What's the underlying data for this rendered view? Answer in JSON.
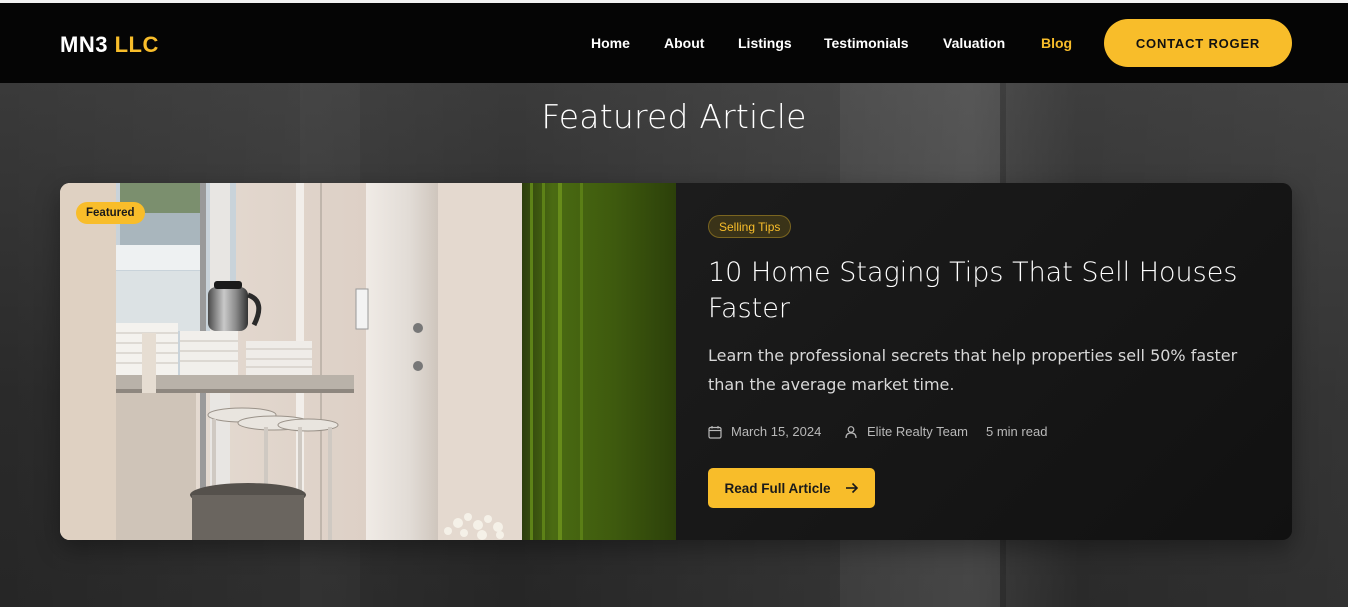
{
  "brand": {
    "name": "MN3",
    "suffix": "LLC"
  },
  "nav": {
    "items": [
      {
        "label": "Home",
        "active": false
      },
      {
        "label": "About",
        "active": false
      },
      {
        "label": "Listings",
        "active": false
      },
      {
        "label": "Testimonials",
        "active": false
      },
      {
        "label": "Valuation",
        "active": false
      },
      {
        "label": "Blog",
        "active": true
      }
    ],
    "cta": "CONTACT ROGER"
  },
  "section": {
    "title": "Featured Article"
  },
  "featured": {
    "badge": "Featured",
    "category": "Selling Tips",
    "title": "10 Home Staging Tips That Sell Houses Faster",
    "excerpt": "Learn the professional secrets that help properties sell 50% faster than the average market time.",
    "date": "March 15, 2024",
    "author": "Elite Realty Team",
    "read_time": "5 min read",
    "button": "Read Full Article",
    "icons": {
      "date": "calendar-icon",
      "author": "user-icon",
      "button": "arrow-right-icon"
    }
  },
  "colors": {
    "accent": "#f8bd2a",
    "navbar": "#050505",
    "card": "#141414"
  }
}
